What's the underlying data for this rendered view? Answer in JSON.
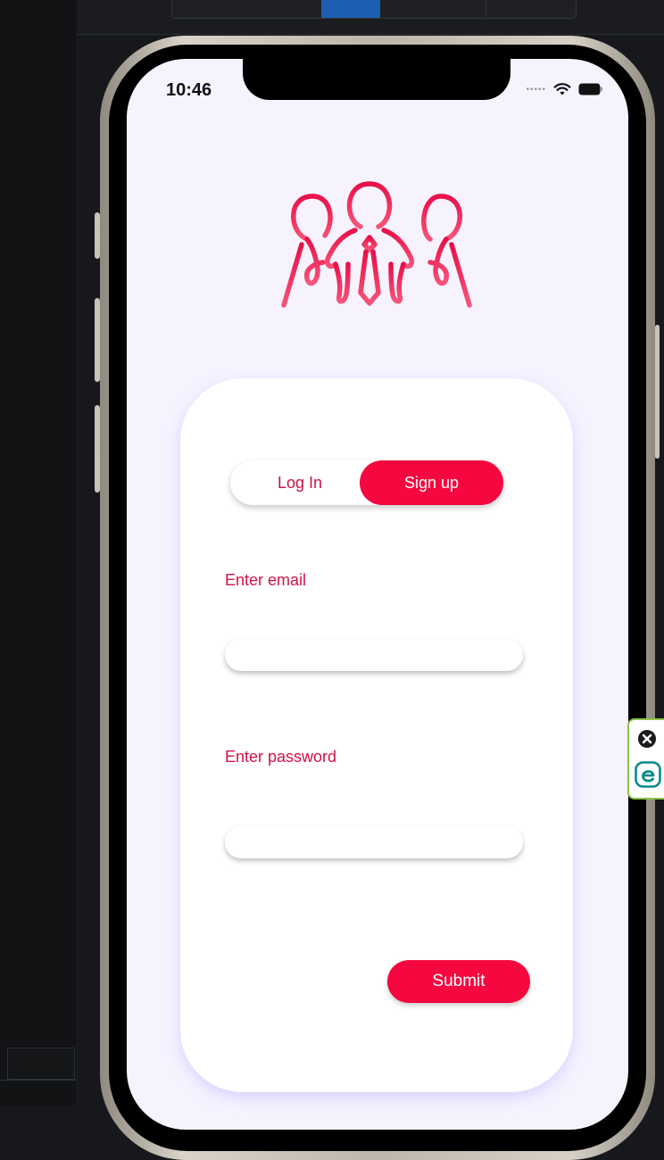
{
  "status_bar": {
    "time": "10:46"
  },
  "auth_toggle": {
    "login_label": "Log In",
    "signup_label": "Sign up",
    "active": "Sign up"
  },
  "form": {
    "email_label": "Enter email",
    "email_value": "",
    "password_label": "Enter password",
    "password_value": "",
    "submit_label": "Submit"
  },
  "icons": {
    "logo": "team-people-logo-icon",
    "wifi": "wifi-icon",
    "battery": "battery-icon",
    "extension_close": "close-icon",
    "extension_logo": "eset-e-icon"
  },
  "colors": {
    "accent": "#f5083f",
    "label_text": "#d11247",
    "screen_background": "#f6f3ff",
    "extension_border": "#8bc34a",
    "extension_e": "#0a8a8a"
  }
}
